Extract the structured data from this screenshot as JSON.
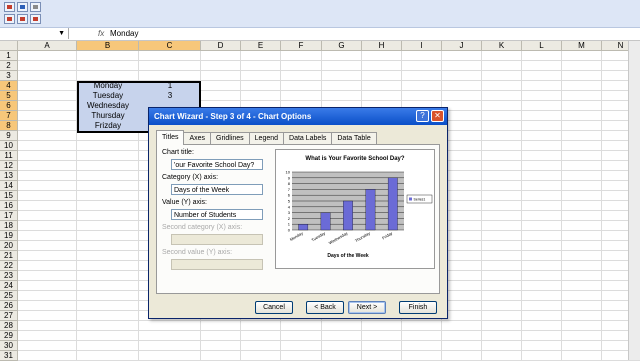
{
  "toolbar": {
    "icons": [
      "undo-icon",
      "redo-icon",
      "print-icon"
    ]
  },
  "formula_bar": {
    "name_box": "",
    "fx_label": "fx",
    "value": "Monday"
  },
  "columns": [
    "A",
    "B",
    "C",
    "D",
    "E",
    "F",
    "G",
    "H",
    "I",
    "J",
    "K",
    "L",
    "M",
    "N"
  ],
  "selected_columns": [
    "B",
    "C"
  ],
  "rows": [
    "1",
    "2",
    "3",
    "4",
    "5",
    "6",
    "7",
    "8",
    "9",
    "10",
    "11",
    "12",
    "13",
    "14",
    "15",
    "16",
    "17",
    "18",
    "19",
    "20",
    "21",
    "22",
    "23",
    "24",
    "25",
    "26",
    "27",
    "28",
    "29",
    "30",
    "31"
  ],
  "selected_rows": [
    "4",
    "5",
    "6",
    "7",
    "8"
  ],
  "cells": {
    "b4": "Monday",
    "c4": "1",
    "b5": "Tuesday",
    "c5": "3",
    "b6": "Wednesday",
    "c6": "",
    "b7": "Thursday",
    "c7": "",
    "b8": "Frizday",
    "c8": ""
  },
  "dialog": {
    "title": "Chart Wizard - Step 3 of 4 - Chart Options",
    "help": "?",
    "close": "✕",
    "tabs": [
      "Titles",
      "Axes",
      "Gridlines",
      "Legend",
      "Data Labels",
      "Data Table"
    ],
    "active_tab": "Titles",
    "chart_title_label": "Chart title:",
    "chart_title_value": "'our Favorite School Day?",
    "category_label": "Category (X) axis:",
    "category_value": "Days of the Week",
    "value_label": "Value (Y) axis:",
    "value_value": "Number of Students",
    "second_category_label": "Second category (X) axis:",
    "second_value_label": "Second value (Y) axis:",
    "buttons": {
      "cancel": "Cancel",
      "back": "< Back",
      "next": "Next >",
      "finish": "Finish"
    }
  },
  "chart_data": {
    "type": "bar",
    "title": "What is Your Favorite School Day?",
    "categories": [
      "Monday",
      "Tuesday",
      "Wednesday",
      "Thursday",
      "Friday"
    ],
    "series": [
      {
        "name": "Series1",
        "values": [
          1,
          3,
          5,
          7,
          9
        ]
      }
    ],
    "xlabel": "Days of the Week",
    "ylabel": "",
    "ylim": [
      0,
      10
    ],
    "yticks": [
      "0",
      "1",
      "2",
      "3",
      "4",
      "5",
      "6",
      "7",
      "8",
      "9",
      "10"
    ],
    "bar_color": "#6b6bd6",
    "grid": true,
    "legend": "right"
  }
}
